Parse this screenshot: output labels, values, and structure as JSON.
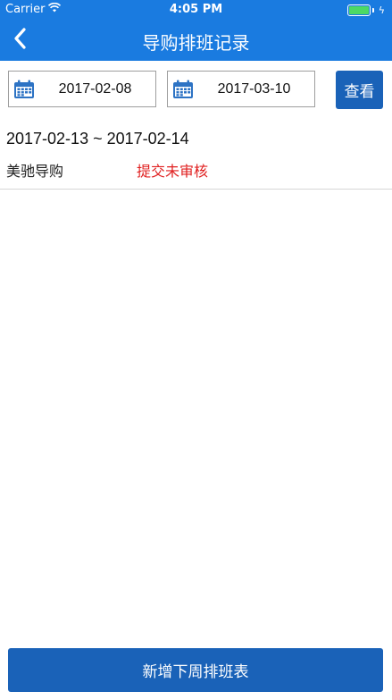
{
  "status_bar": {
    "carrier": "Carrier",
    "time": "4:05 PM"
  },
  "nav": {
    "title": "导购排班记录"
  },
  "filters": {
    "start_date": "2017-02-08",
    "end_date": "2017-03-10",
    "view_label": "查看"
  },
  "records": [
    {
      "range": "2017-02-13 ~ 2017-02-14",
      "guide": "美驰导购",
      "status": "提交未审核"
    }
  ],
  "footer": {
    "add_label": "新增下周排班表"
  },
  "colors": {
    "primary": "#1a7be0",
    "button": "#1a62b8",
    "status_red": "#e02020"
  }
}
